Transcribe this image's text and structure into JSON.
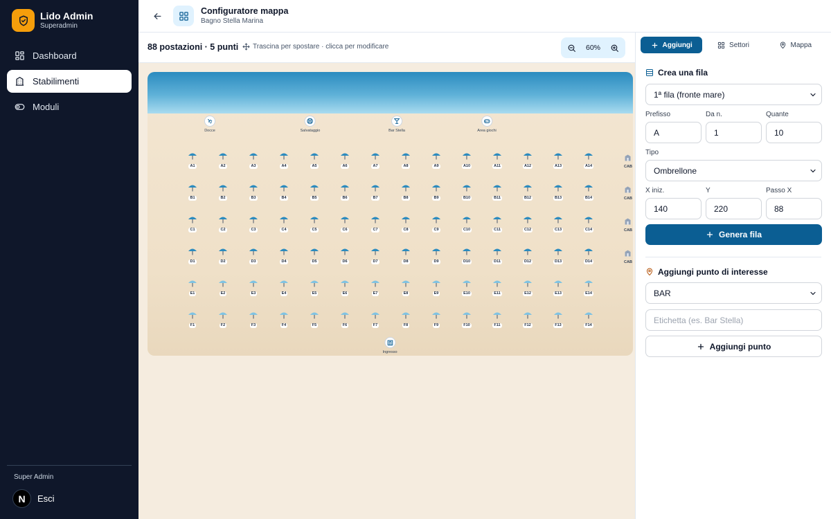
{
  "sidebar": {
    "brand_title": "Lido Admin",
    "brand_subtitle": "Superadmin",
    "items": [
      {
        "label": "Dashboard",
        "icon": "dashboard-icon",
        "active": false
      },
      {
        "label": "Stabilimenti",
        "icon": "building-icon",
        "active": true
      },
      {
        "label": "Moduli",
        "icon": "toggle-icon",
        "active": false
      }
    ],
    "role": "Super Admin",
    "avatar_letter": "N",
    "logout_label": "Esci"
  },
  "header": {
    "title": "Configuratore mappa",
    "subtitle": "Bagno Stella Marina"
  },
  "toolbar": {
    "count": "88 postazioni · 5 punti",
    "hint": "Trascina per spostare · clicca per modificare",
    "zoom": "60%"
  },
  "map": {
    "pois": [
      {
        "label": "Docce",
        "icon": "shower-icon"
      },
      {
        "label": "Salvataggio",
        "icon": "lifebuoy-icon"
      },
      {
        "label": "Bar Stella",
        "icon": "cocktail-icon"
      },
      {
        "label": "Area giochi",
        "icon": "gamepad-icon"
      },
      {
        "label": "Ingresso",
        "icon": "entrance-icon"
      }
    ],
    "rows": [
      "A",
      "B",
      "C",
      "D",
      "E",
      "F"
    ],
    "per_row": 14,
    "cabins": [
      "CAB",
      "CAB",
      "CAB",
      "CAB"
    ],
    "colors": {
      "umbrella": "#2b8bbf",
      "umbrella_light": "#7fc3e3",
      "sea": "#3a98c9",
      "sand": "#f0e2cb"
    }
  },
  "panel": {
    "tabs": [
      {
        "label": "Aggiungi",
        "icon": "plus-icon",
        "active": true
      },
      {
        "label": "Settori",
        "icon": "grid-icon",
        "active": false
      },
      {
        "label": "Mappa",
        "icon": "pin-icon",
        "active": false
      }
    ],
    "row_section": {
      "title": "Crea una fila",
      "row_select": "1ª fila (fronte mare)",
      "prefix_label": "Prefisso",
      "prefix_value": "A",
      "from_label": "Da n.",
      "from_value": "1",
      "count_label": "Quante",
      "count_value": "10",
      "type_label": "Tipo",
      "type_value": "Ombrellone",
      "x_label": "X iniz.",
      "x_value": "140",
      "y_label": "Y",
      "y_value": "220",
      "step_label": "Passo X",
      "step_value": "88",
      "generate_label": "Genera fila"
    },
    "poi_section": {
      "title": "Aggiungi punto di interesse",
      "type_value": "BAR",
      "label_placeholder": "Etichetta (es. Bar Stella)",
      "add_label": "Aggiungi punto"
    },
    "accent": "#0b5e93"
  }
}
